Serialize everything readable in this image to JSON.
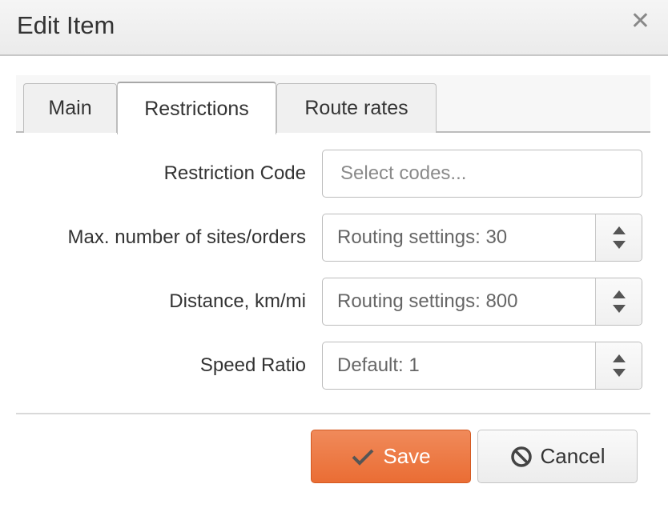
{
  "dialog": {
    "title": "Edit Item",
    "close_icon": "close-icon"
  },
  "tabs": [
    {
      "label": "Main",
      "active": false
    },
    {
      "label": "Restrictions",
      "active": true
    },
    {
      "label": "Route rates",
      "active": false
    }
  ],
  "form": {
    "restriction_code": {
      "label": "Restriction Code",
      "placeholder": "Select codes..."
    },
    "max_sites": {
      "label": "Max. number of sites/orders",
      "placeholder": "Routing settings: 30"
    },
    "distance": {
      "label": "Distance, km/mi",
      "placeholder": "Routing settings: 800"
    },
    "speed_ratio": {
      "label": "Speed Ratio",
      "placeholder": "Default: 1"
    }
  },
  "footer": {
    "save_label": "Save",
    "save_icon": "check-icon",
    "cancel_label": "Cancel",
    "cancel_icon": "ban-icon"
  },
  "colors": {
    "accent": "#ea6d34"
  }
}
